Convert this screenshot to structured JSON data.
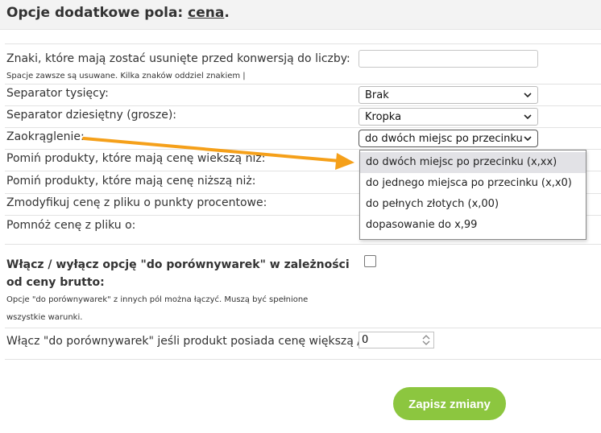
{
  "header": {
    "title_prefix": "Opcje dodatkowe pola: ",
    "field_name": "cena",
    "title_suffix": "."
  },
  "rows": {
    "strip_chars": {
      "label": "Znaki, które mają zostać usunięte przed konwersją do liczby:",
      "hint": "Spacje zawsze są usuwane. Kilka znaków oddziel znakiem |",
      "value": ""
    },
    "thousands_sep": {
      "label": "Separator tysięcy:",
      "selected": "Brak"
    },
    "decimal_sep": {
      "label": "Separator dziesiętny (grosze):",
      "selected": "Kropka"
    },
    "rounding": {
      "label": "Zaokrąglenie:",
      "selected": "do dwóch miejsc po przecinku (x,xx)",
      "options": [
        "do dwóch miejsc po przecinku (x,xx)",
        "do jednego miejsca po przecinku (x,x0)",
        "do pełnych złotych (x,00)",
        "dopasowanie do x,99"
      ],
      "highlighted_index": 0
    },
    "skip_greater": {
      "label": "Pomiń produkty, które mają cenę wiekszą niż:"
    },
    "skip_lower": {
      "label": "Pomiń produkty, które mają cenę niższą niż:"
    },
    "modify_percent": {
      "label": "Zmodyfikuj cenę z pliku o punkty procentowe:"
    },
    "multiply": {
      "label": "Pomnóż cenę z pliku o:"
    }
  },
  "comparison": {
    "title": "Włącz / wyłącz opcję \"do porównywarek\" w zależności od ceny brutto:",
    "checked": false,
    "hint": "Opcje \"do porównywarek\" z innych pól można łączyć. Muszą być spełnione wszystkie warunki.",
    "threshold_label": "Włącz \"do porównywarek\" jeśli produkt posiada cenę większą / równą:",
    "threshold_value": "0"
  },
  "actions": {
    "save_label": "Zapisz zmiany"
  },
  "colors": {
    "accent_button": "#8cc63f",
    "annotation_arrow": "#f5a01a",
    "header_bg": "#f3f3f3",
    "dropdown_highlight": "#e2e2e6"
  },
  "icons": {
    "select_chevron": "chevron-down-icon",
    "annotation": "arrow-annotation-icon",
    "spinner": "number-spinner-icon"
  }
}
